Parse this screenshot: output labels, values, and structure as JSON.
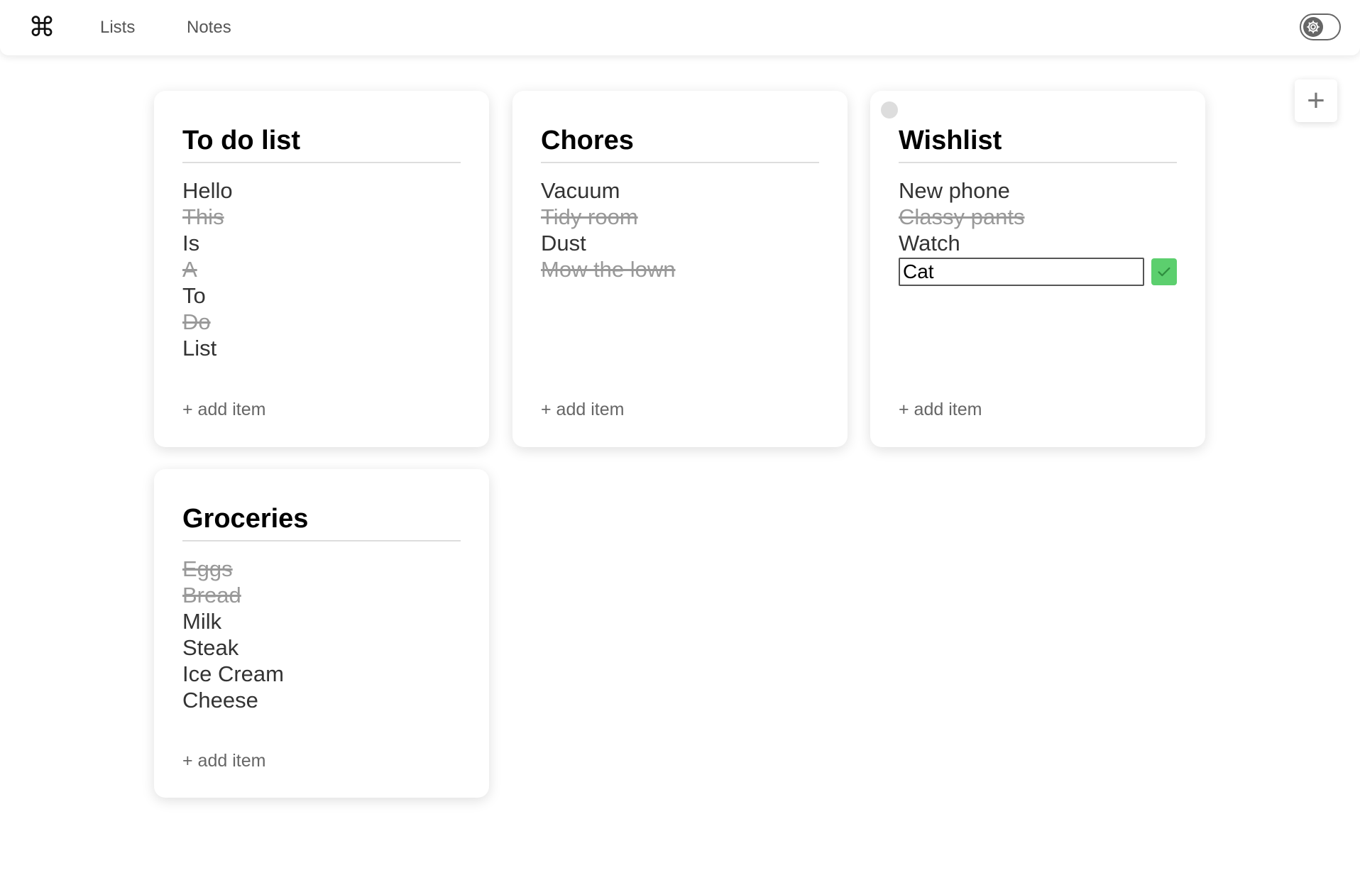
{
  "nav": {
    "logo_icon": "command-key-icon",
    "logo_glyph": "⌘",
    "links": [
      "Lists",
      "Notes"
    ],
    "settings_icon": "gear-icon"
  },
  "add_list": {
    "icon": "plus-icon",
    "glyph": "+"
  },
  "lists": [
    {
      "title": "To do list",
      "items": [
        {
          "text": "Hello",
          "done": false
        },
        {
          "text": "This",
          "done": true
        },
        {
          "text": "Is",
          "done": false
        },
        {
          "text": "A",
          "done": true
        },
        {
          "text": "To",
          "done": false
        },
        {
          "text": "Do",
          "done": true
        },
        {
          "text": "List",
          "done": false
        }
      ],
      "add_item_label": "+ add item"
    },
    {
      "title": "Chores",
      "items": [
        {
          "text": "Vacuum",
          "done": false
        },
        {
          "text": "Tidy room",
          "done": true
        },
        {
          "text": "Dust",
          "done": false
        },
        {
          "text": "Mow the lown",
          "done": true
        }
      ],
      "add_item_label": "+ add item"
    },
    {
      "title": "Wishlist",
      "items": [
        {
          "text": "New phone",
          "done": false
        },
        {
          "text": "Classy pants",
          "done": true
        },
        {
          "text": "Watch",
          "done": false
        }
      ],
      "editing": {
        "value": "Cat",
        "confirm_icon": "checkmark-icon"
      },
      "add_item_label": "+ add item"
    },
    {
      "title": "Groceries",
      "items": [
        {
          "text": "Eggs",
          "done": true
        },
        {
          "text": "Bread",
          "done": true
        },
        {
          "text": "Milk",
          "done": false
        },
        {
          "text": "Steak",
          "done": false
        },
        {
          "text": "Ice Cream",
          "done": false
        },
        {
          "text": "Cheese",
          "done": false
        }
      ],
      "add_item_label": "+ add item"
    }
  ],
  "colors": {
    "accent_green": "#5ccf6e",
    "done_text": "#999999",
    "text": "#333333"
  }
}
